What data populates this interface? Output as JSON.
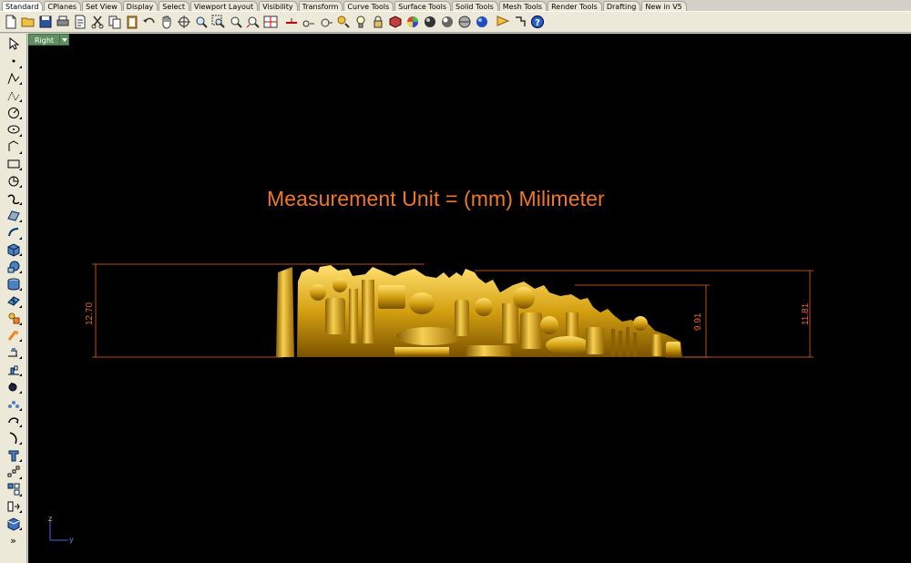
{
  "tabs": [
    {
      "label": "Standard",
      "active": true
    },
    {
      "label": "CPlanes"
    },
    {
      "label": "Set View"
    },
    {
      "label": "Display"
    },
    {
      "label": "Select"
    },
    {
      "label": "Viewport Layout"
    },
    {
      "label": "Visibility"
    },
    {
      "label": "Transform"
    },
    {
      "label": "Curve Tools"
    },
    {
      "label": "Surface Tools"
    },
    {
      "label": "Solid Tools"
    },
    {
      "label": "Mesh Tools"
    },
    {
      "label": "Render Tools"
    },
    {
      "label": "Drafting"
    },
    {
      "label": "New in V5"
    }
  ],
  "viewport": {
    "name": "Right",
    "annotation": "Measurement Unit = (mm) Milimeter",
    "dimensions": {
      "left": "12.70",
      "middle": "9.91",
      "right": "11.81"
    },
    "axis": {
      "vertical": "z",
      "horizontal": "y"
    }
  },
  "left_toolbar": {
    "more_label": "»"
  },
  "colors": {
    "annotation": "#f07828",
    "dimension": "#e8641e",
    "model_gold": "#d4a010",
    "viewport_bg": "#000000",
    "viewport_tab": "#5f8f5f"
  }
}
